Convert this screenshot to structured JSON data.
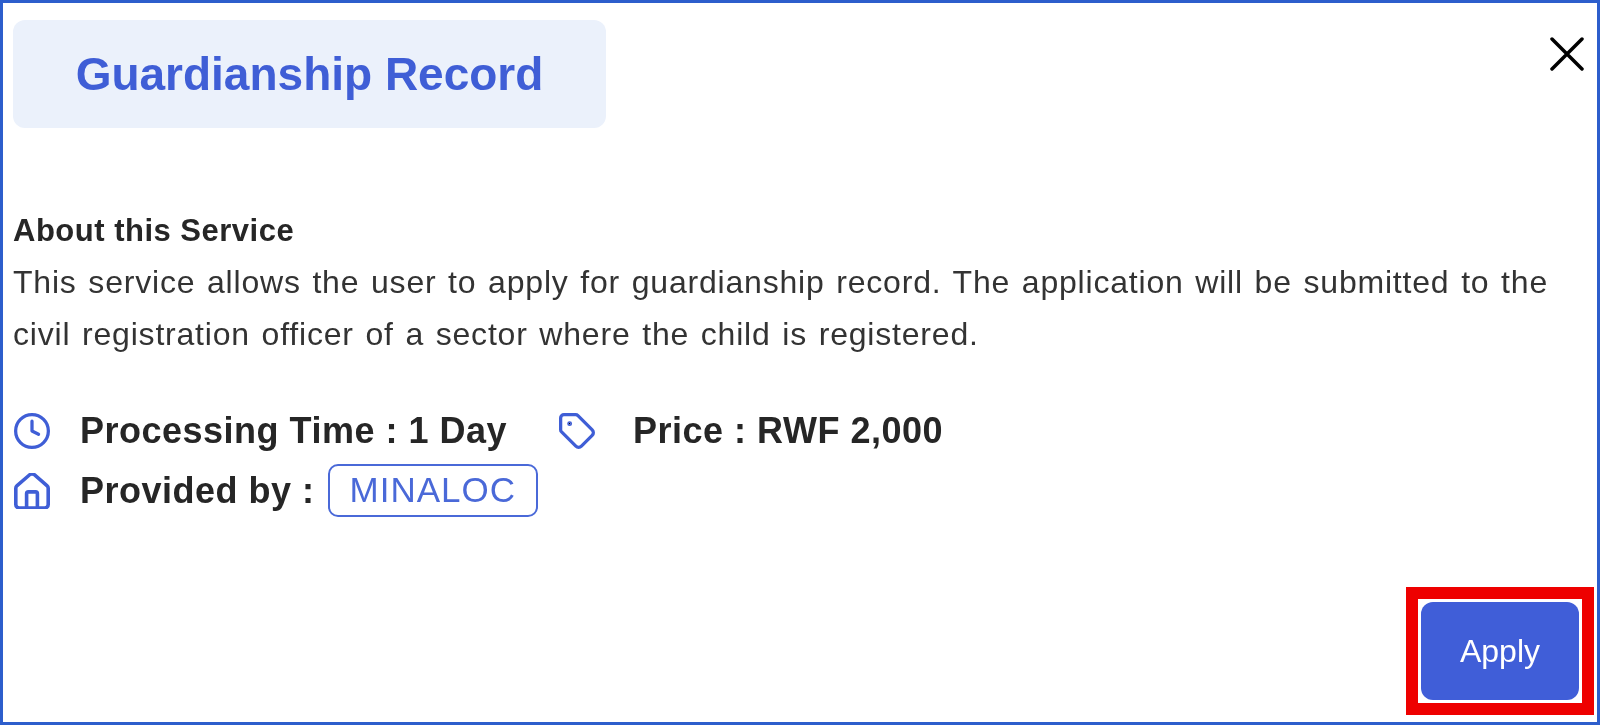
{
  "dialog": {
    "title": "Guardianship Record"
  },
  "about": {
    "heading": "About this Service",
    "description": "This service allows the user to apply for guardianship record. The application will be submitted to the civil registration officer of a sector where the child is registered."
  },
  "info": {
    "processing_time": "Processing Time : 1 Day",
    "price": "Price : RWF 2,000",
    "provided_by_label": "Provided by :",
    "provider": "MINALOC"
  },
  "apply_button": {
    "label": "Apply",
    "highlighted": true
  }
}
